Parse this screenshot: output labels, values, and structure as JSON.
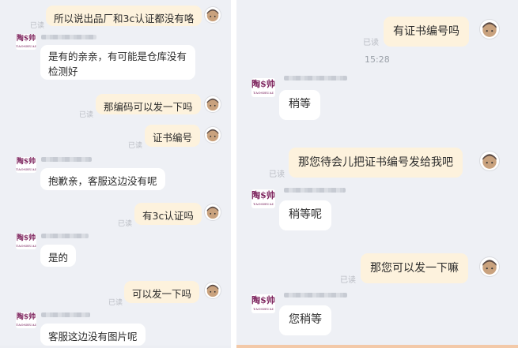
{
  "left": {
    "messages": [
      {
        "dir": "out",
        "text": "所以说出品厂和3c认证都没有咯",
        "read": "已读"
      },
      {
        "dir": "in",
        "text": "是有的亲亲，有可能是仓库没有检测好"
      },
      {
        "dir": "out",
        "text": "那编码可以发一下吗",
        "read": "已读"
      },
      {
        "dir": "out",
        "text": "证书编号",
        "read": "已读"
      },
      {
        "dir": "in",
        "text": "抱歉亲，客服这边没有呢"
      },
      {
        "dir": "out",
        "text": "有3c认证吗",
        "read": "已读"
      },
      {
        "dir": "in",
        "text": "是的"
      },
      {
        "dir": "out",
        "text": "可以发一下吗",
        "read": "已读"
      },
      {
        "dir": "in",
        "text": "客服这边没有图片呢"
      }
    ]
  },
  "right": {
    "time": "15:28",
    "messages": [
      {
        "dir": "out",
        "text": "有证书编号吗",
        "read": "已读"
      },
      {
        "dir": "in",
        "text": "稍等"
      },
      {
        "dir": "out",
        "text": "那您待会儿把证书编号发给我吧",
        "read": "已读"
      },
      {
        "dir": "in",
        "text": "稍等呢"
      },
      {
        "dir": "out",
        "text": "那您可以发一下嘛",
        "read": "已读"
      },
      {
        "dir": "in",
        "text": "您稍等"
      }
    ]
  },
  "shop_avatar": {
    "logo": "陶$帅",
    "sub": "TAOSHUAI"
  },
  "colors": {
    "panel_bg": "#eef0f5",
    "outgoing_bubble": "#fdf2dd",
    "incoming_bubble": "#ffffff",
    "read_text": "#b9bcc3"
  }
}
